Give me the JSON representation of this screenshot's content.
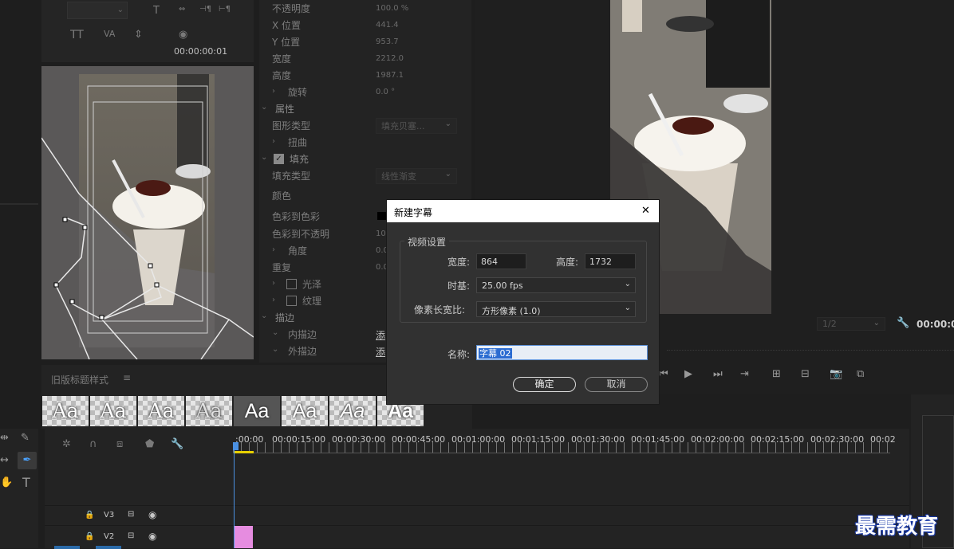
{
  "timecodes": {
    "left_panel": "00:00:00:01",
    "program_top": "00:00:0",
    "program_zoom": "1/2"
  },
  "properties": [
    {
      "label": "不透明度",
      "value": "100.0 %"
    },
    {
      "label": "X 位置",
      "value": "441.4"
    },
    {
      "label": "Y 位置",
      "value": "953.7"
    },
    {
      "label": "宽度",
      "value": "2212.0"
    },
    {
      "label": "高度",
      "value": "1987.1"
    },
    {
      "label": "旋转",
      "value": "0.0 °"
    },
    {
      "label": "属性",
      "value": ""
    },
    {
      "label": "图形类型",
      "value": "填充贝塞..."
    },
    {
      "label": "扭曲",
      "value": ""
    },
    {
      "label": "填充",
      "value": ""
    },
    {
      "label": "填充类型",
      "value": "线性渐变"
    },
    {
      "label": "颜色",
      "value": ""
    },
    {
      "label": "色彩到色彩",
      "value": ""
    },
    {
      "label": "色彩到不透明",
      "value": "10"
    },
    {
      "label": "角度",
      "value": "0.0"
    },
    {
      "label": "重复",
      "value": "0.0"
    },
    {
      "label": "光泽",
      "value": ""
    },
    {
      "label": "纹理",
      "value": ""
    },
    {
      "label": "描边",
      "value": ""
    },
    {
      "label": "内描边",
      "value": "添"
    },
    {
      "label": "外描边",
      "value": "添"
    }
  ],
  "styles_panel": {
    "title": "旧版标题样式",
    "menu_icon": "≡",
    "tiles": [
      "Aa",
      "Aa",
      "Aa",
      "Aa",
      "Aa",
      "Aa",
      "Aa",
      "Aa"
    ]
  },
  "dialog": {
    "title": "新建字幕",
    "close": "✕",
    "group_title": "视频设置",
    "width_label": "宽度:",
    "width_value": "864",
    "height_label": "高度:",
    "height_value": "1732",
    "timebase_label": "时基:",
    "timebase_value": "25.00 fps",
    "aspect_label": "像素长宽比:",
    "aspect_value": "方形像素 (1.0)",
    "name_label": "名称:",
    "name_value": "字幕 02",
    "ok": "确定",
    "cancel": "取消"
  },
  "timeline": {
    "ticks": [
      ":00:00",
      "00:00:15:00",
      "00:00:30:00",
      "00:00:45:00",
      "00:01:00:00",
      "00:01:15:00",
      "00:01:30:00",
      "00:01:45:00",
      "00:02:00:00",
      "00:02:15:00",
      "00:02:30:00",
      "00:02"
    ],
    "tracks": [
      {
        "name": "V3"
      },
      {
        "name": "V2"
      }
    ]
  },
  "watermark": "最需教育"
}
